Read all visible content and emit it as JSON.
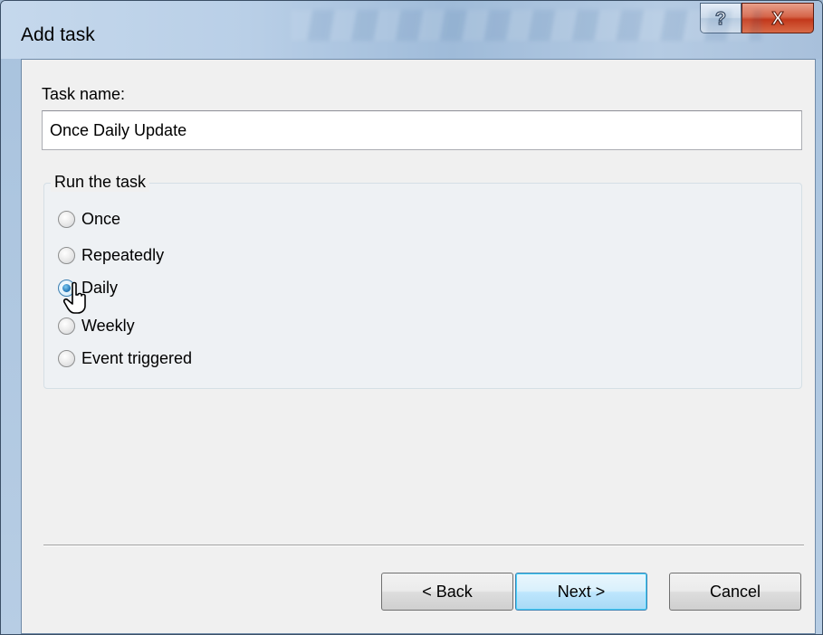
{
  "window": {
    "title": "Add task",
    "help_label": "?",
    "close_label": "X"
  },
  "form": {
    "task_name_label": "Task name:",
    "task_name_value": "Once Daily Update",
    "group_title": "Run the task",
    "options": [
      {
        "label": "Once",
        "checked": false
      },
      {
        "label": "Repeatedly",
        "checked": false
      },
      {
        "label": "Daily",
        "checked": true
      },
      {
        "label": "Weekly",
        "checked": false
      },
      {
        "label": "Event triggered",
        "checked": false
      }
    ]
  },
  "buttons": {
    "back": "< Back",
    "next": "Next >",
    "cancel": "Cancel"
  },
  "colors": {
    "accent": "#3c7fb1",
    "close_red": "#c3381b",
    "panel_bg": "#f0f0f0"
  }
}
